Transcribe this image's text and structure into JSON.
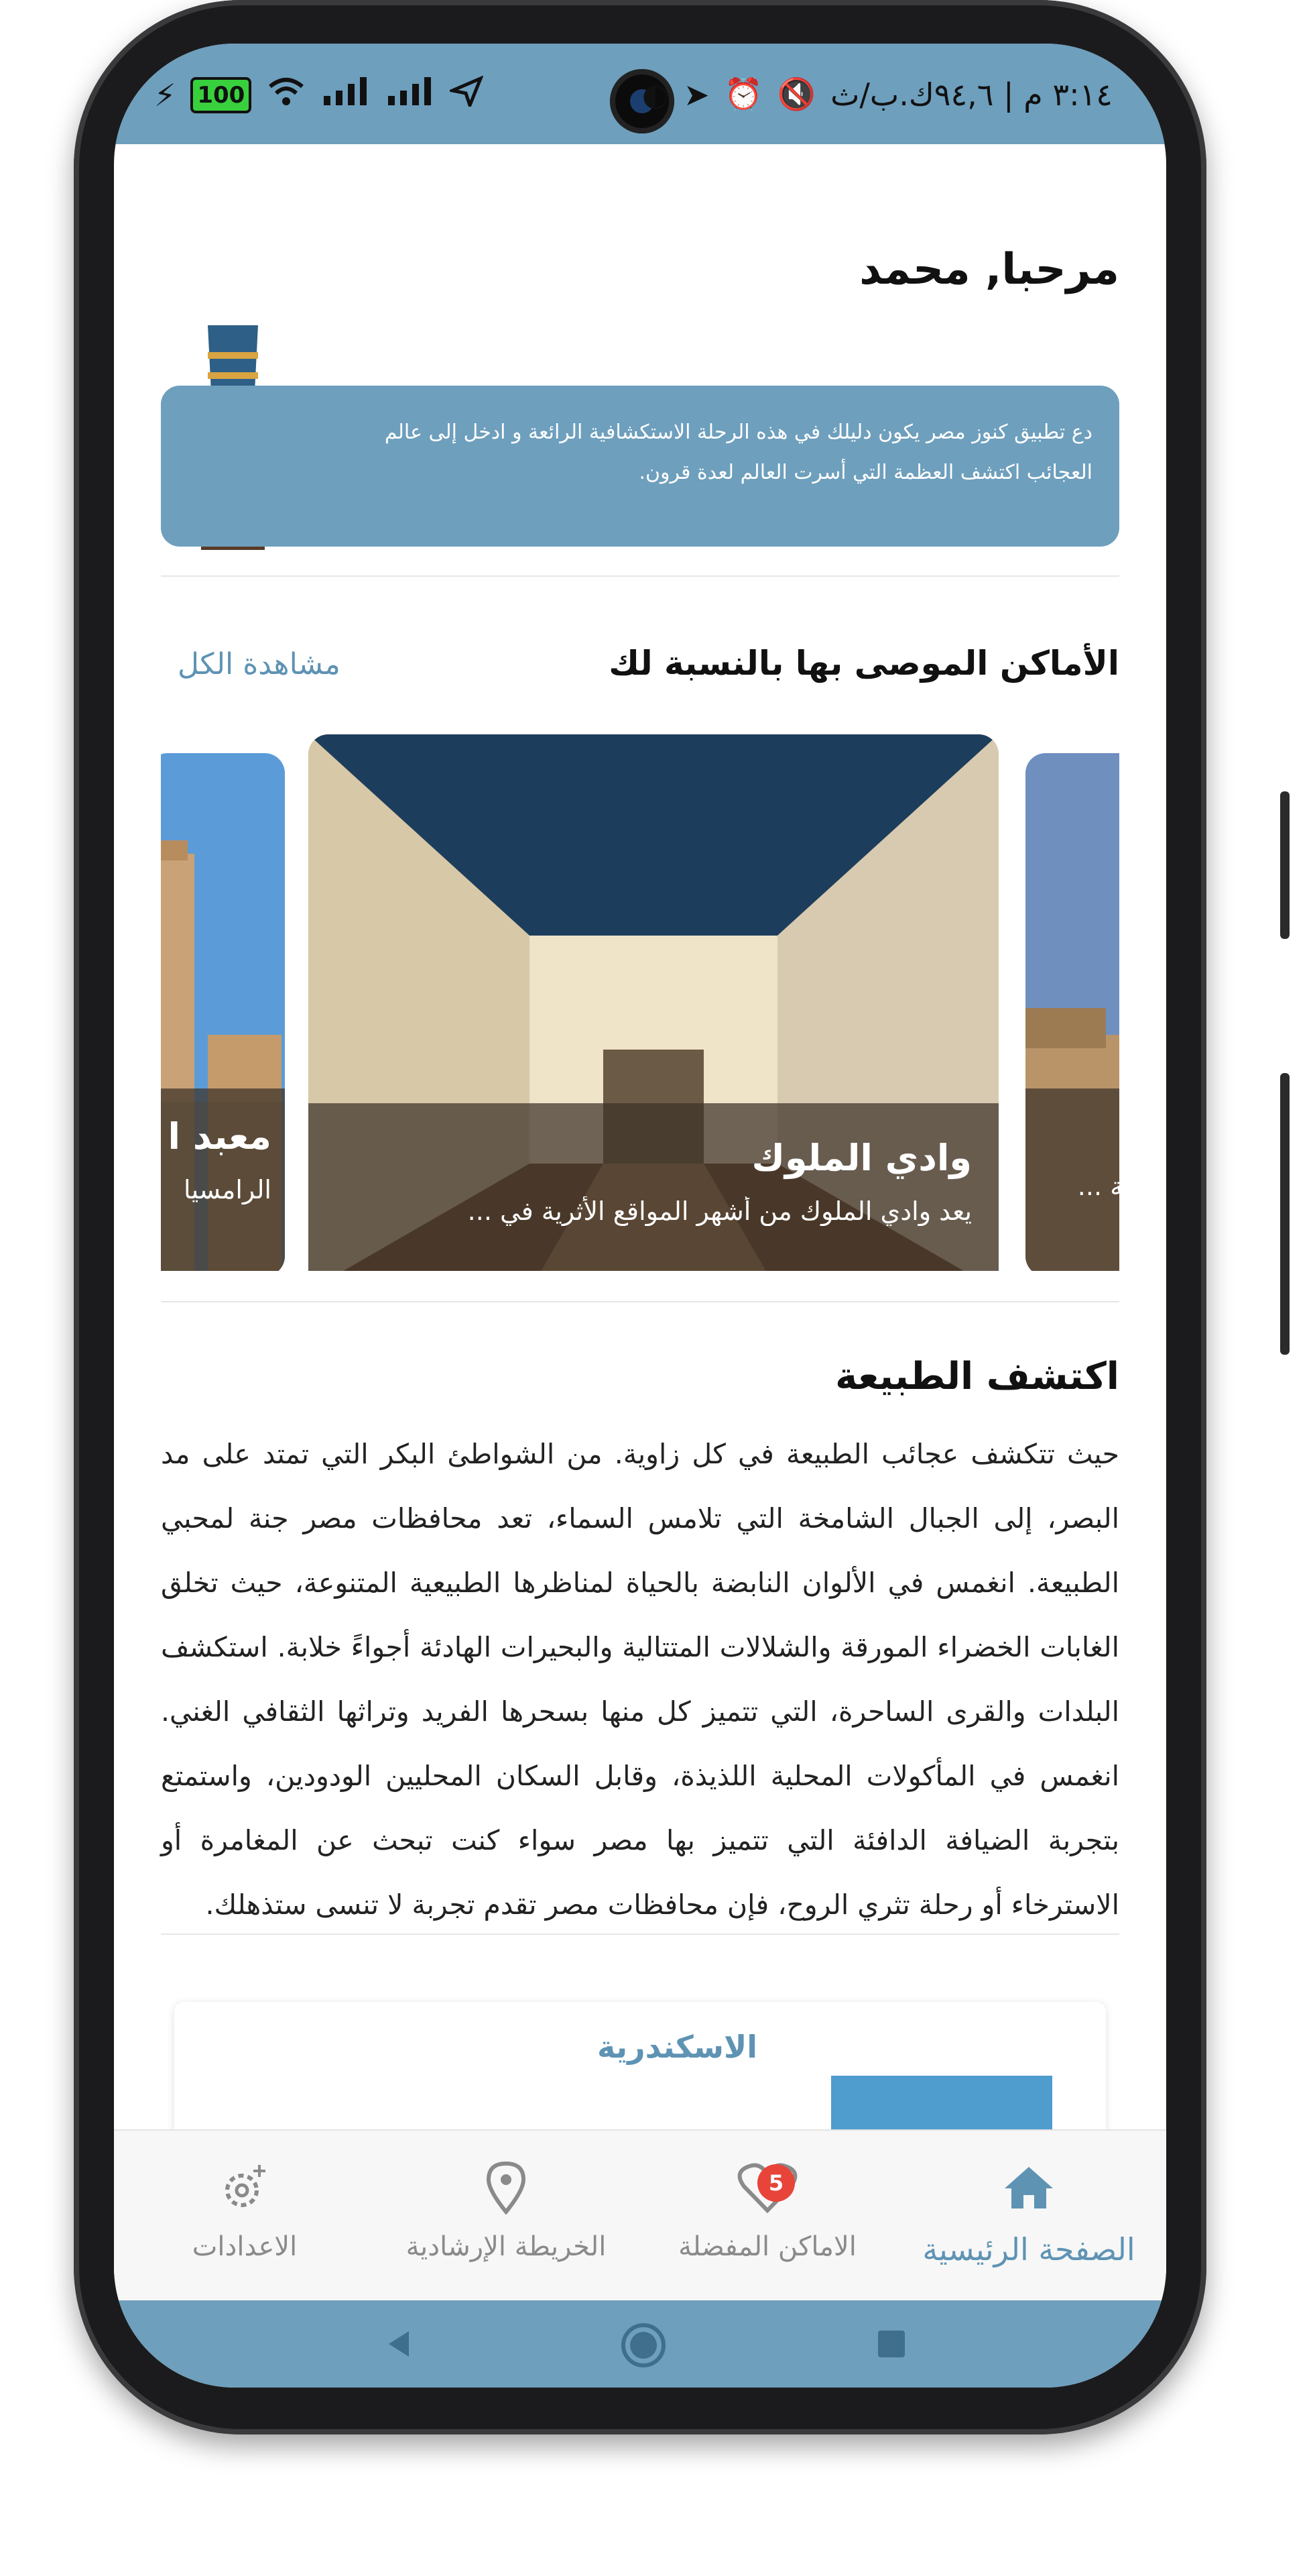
{
  "status_bar": {
    "time_text": "٣:١٤ م | ٩٤,٦ك.ب/ث",
    "battery": "100",
    "signal_icons": [
      "wifi-icon",
      "signal-icon",
      "signal-icon",
      "location-icon"
    ],
    "right_icons": [
      "notification-icon",
      "telegram-icon",
      "alarm-icon",
      "mute-icon"
    ]
  },
  "header": {
    "greeting": "مرحبا,  محمد"
  },
  "welcome_banner": {
    "line1": "دع تطبيق كنوز مصر يكون دليلك في هذه الرحلة الاستكشافية الرائعة و ادخل إلى عالم",
    "line2": "العجائب اكتشف العظمة  التي أسرت العالم لعدة قرون."
  },
  "recommended": {
    "title": "الأماكن الموصى بها بالنسبة لك",
    "see_all": "مشاهدة الكل",
    "cards": [
      {
        "title": "وادي الملوك",
        "desc": "يعد وادي الملوك من أشهر المواقع الأثرية في ..."
      },
      {
        "title": "معبد ا",
        "desc": "الرامسيا"
      },
      {
        "title": "",
        "desc": "ينية ..."
      }
    ]
  },
  "nature": {
    "title": "اكتشف الطبيعة",
    "text": "حيث تتكشف عجائب الطبيعة في كل زاوية. من الشواطئ البكر التي تمتد على مد البصر، إلى الجبال الشامخة التي تلامس السماء، تعد محافظات مصر جنة لمحبي الطبيعة. انغمس في الألوان النابضة بالحياة لمناظرها الطبيعية المتنوعة، حيث تخلق الغابات الخضراء المورقة والشلالات المتتالية والبحيرات الهادئة أجواءً خلابة. استكشف البلدات والقرى الساحرة، التي تتميز كل منها بسحرها الفريد وتراثها الثقافي الغني. انغمس في المأكولات المحلية اللذيذة، وقابل السكان المحليين الودودين، واستمتع بتجربة الضيافة الدافئة التي تتميز بها مصر سواء كنت تبحث عن المغامرة أو الاسترخاء أو رحلة تثري الروح، فإن محافظات مصر تقدم تجربة لا تنسى ستذهلك."
  },
  "place_card": {
    "name": "الاسكندرية"
  },
  "bottom_nav": {
    "home": "الصفحة الرئيسية",
    "favorites": "الاماكن المفضلة",
    "favorites_badge": "5",
    "map": "الخريطة الإرشادية",
    "settings": "الاعدادات"
  },
  "colors": {
    "accent": "#6e9fbd",
    "link": "#5e93b4",
    "badge": "#e8443a"
  }
}
